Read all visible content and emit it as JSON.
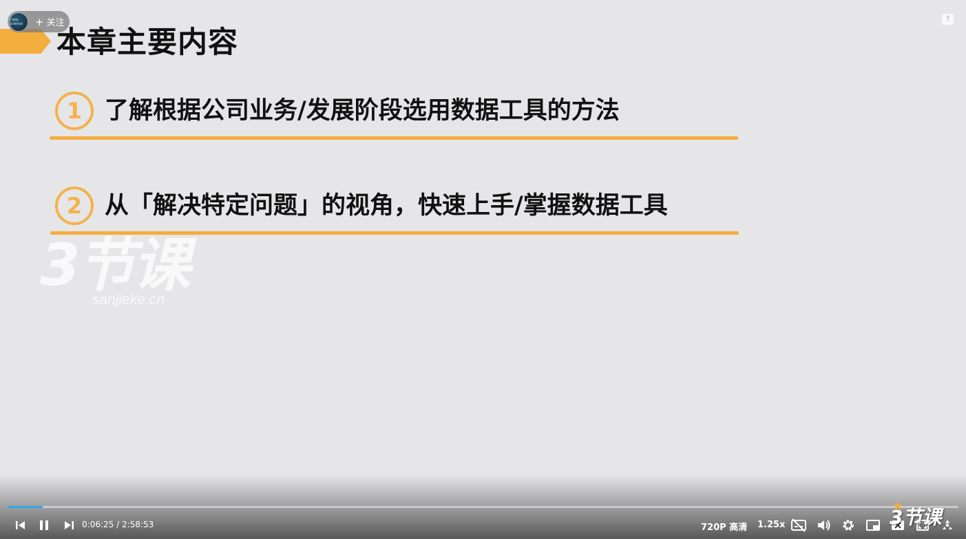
{
  "slide": {
    "title": "本章主要内容",
    "points": [
      {
        "num": "1",
        "text": "了解根据公司业务/发展阶段选用数据工具的方法"
      },
      {
        "num": "2",
        "text": "从「解决特定问题」的视角，快速上手/掌握数据工具"
      }
    ],
    "watermark": {
      "brand": "3节课",
      "site": "sanjieke.cn"
    }
  },
  "overlay": {
    "follow_label": "关注",
    "avatar_text": "Data Science",
    "help": "?"
  },
  "player": {
    "current_time": "0:06:25",
    "separator": "/",
    "duration": "2:58:53",
    "progress": 0.036,
    "quality": "720P 高清",
    "speed": "1.25x",
    "logo": "3节课",
    "accent_color": "#2ea8e8"
  },
  "colors": {
    "highlight": "#f4ae3d",
    "background": "#e6e6e8"
  }
}
